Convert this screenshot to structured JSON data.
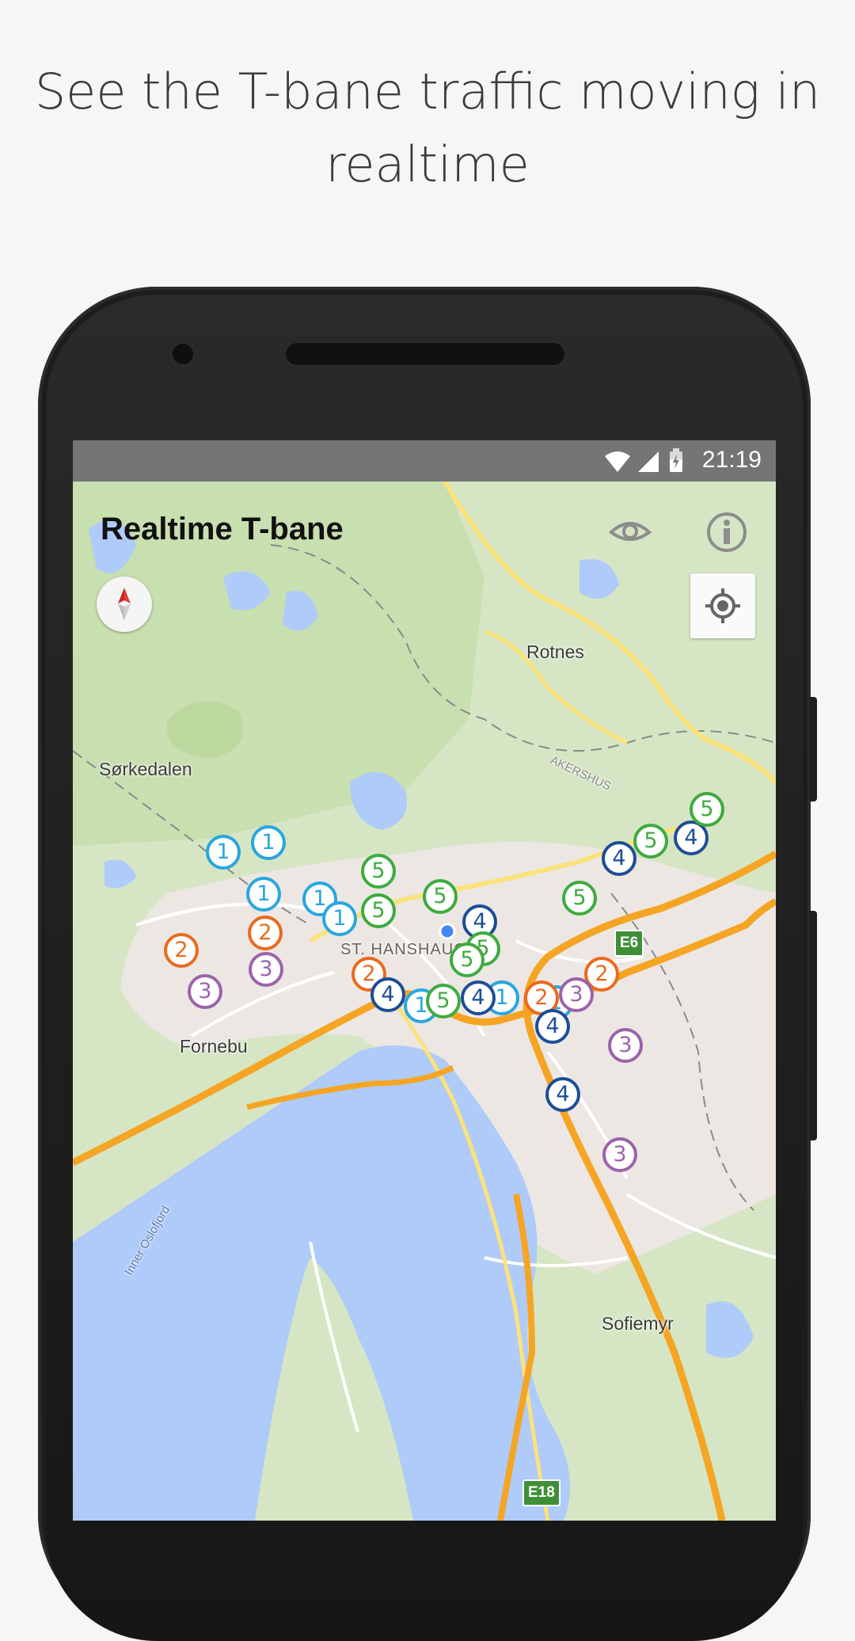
{
  "headline": {
    "line1": "See the T-bane traffic moving in",
    "line2": "realtime"
  },
  "status_bar": {
    "time": "21:19",
    "icons": [
      "wifi-icon",
      "signal-icon",
      "battery-charging-icon"
    ]
  },
  "app": {
    "title": "Realtime T-bane",
    "toolbar_icons": [
      "eye-icon",
      "info-icon"
    ],
    "compass_icon": "compass-icon",
    "locate_icon": "my-location-icon"
  },
  "map": {
    "places": [
      {
        "name": "Rotnes"
      },
      {
        "name": "Sørkedalen"
      },
      {
        "name": "Fornebu"
      },
      {
        "name": "ST. HANSHAUGEN"
      },
      {
        "name": "Sofiemyr"
      },
      {
        "name": "AKERSHUS"
      },
      {
        "name": "Inner Oslofjord"
      }
    ],
    "road_shields": [
      "E6",
      "E18"
    ],
    "line_colors": {
      "1": "#29a6df",
      "2": "#ea6a1e",
      "3": "#9c63ab",
      "4": "#1d4d97",
      "5": "#3eab3f"
    },
    "trains": [
      {
        "line": "1"
      },
      {
        "line": "1"
      },
      {
        "line": "1"
      },
      {
        "line": "1"
      },
      {
        "line": "1"
      },
      {
        "line": "1"
      },
      {
        "line": "1"
      },
      {
        "line": "1"
      },
      {
        "line": "2"
      },
      {
        "line": "2"
      },
      {
        "line": "2"
      },
      {
        "line": "2"
      },
      {
        "line": "2"
      },
      {
        "line": "3"
      },
      {
        "line": "3"
      },
      {
        "line": "3"
      },
      {
        "line": "3"
      },
      {
        "line": "3"
      },
      {
        "line": "4"
      },
      {
        "line": "4"
      },
      {
        "line": "4"
      },
      {
        "line": "4"
      },
      {
        "line": "4"
      },
      {
        "line": "4"
      },
      {
        "line": "4"
      },
      {
        "line": "5"
      },
      {
        "line": "5"
      },
      {
        "line": "5"
      },
      {
        "line": "5"
      },
      {
        "line": "5"
      },
      {
        "line": "5"
      },
      {
        "line": "5"
      },
      {
        "line": "5"
      },
      {
        "line": "5"
      }
    ]
  }
}
